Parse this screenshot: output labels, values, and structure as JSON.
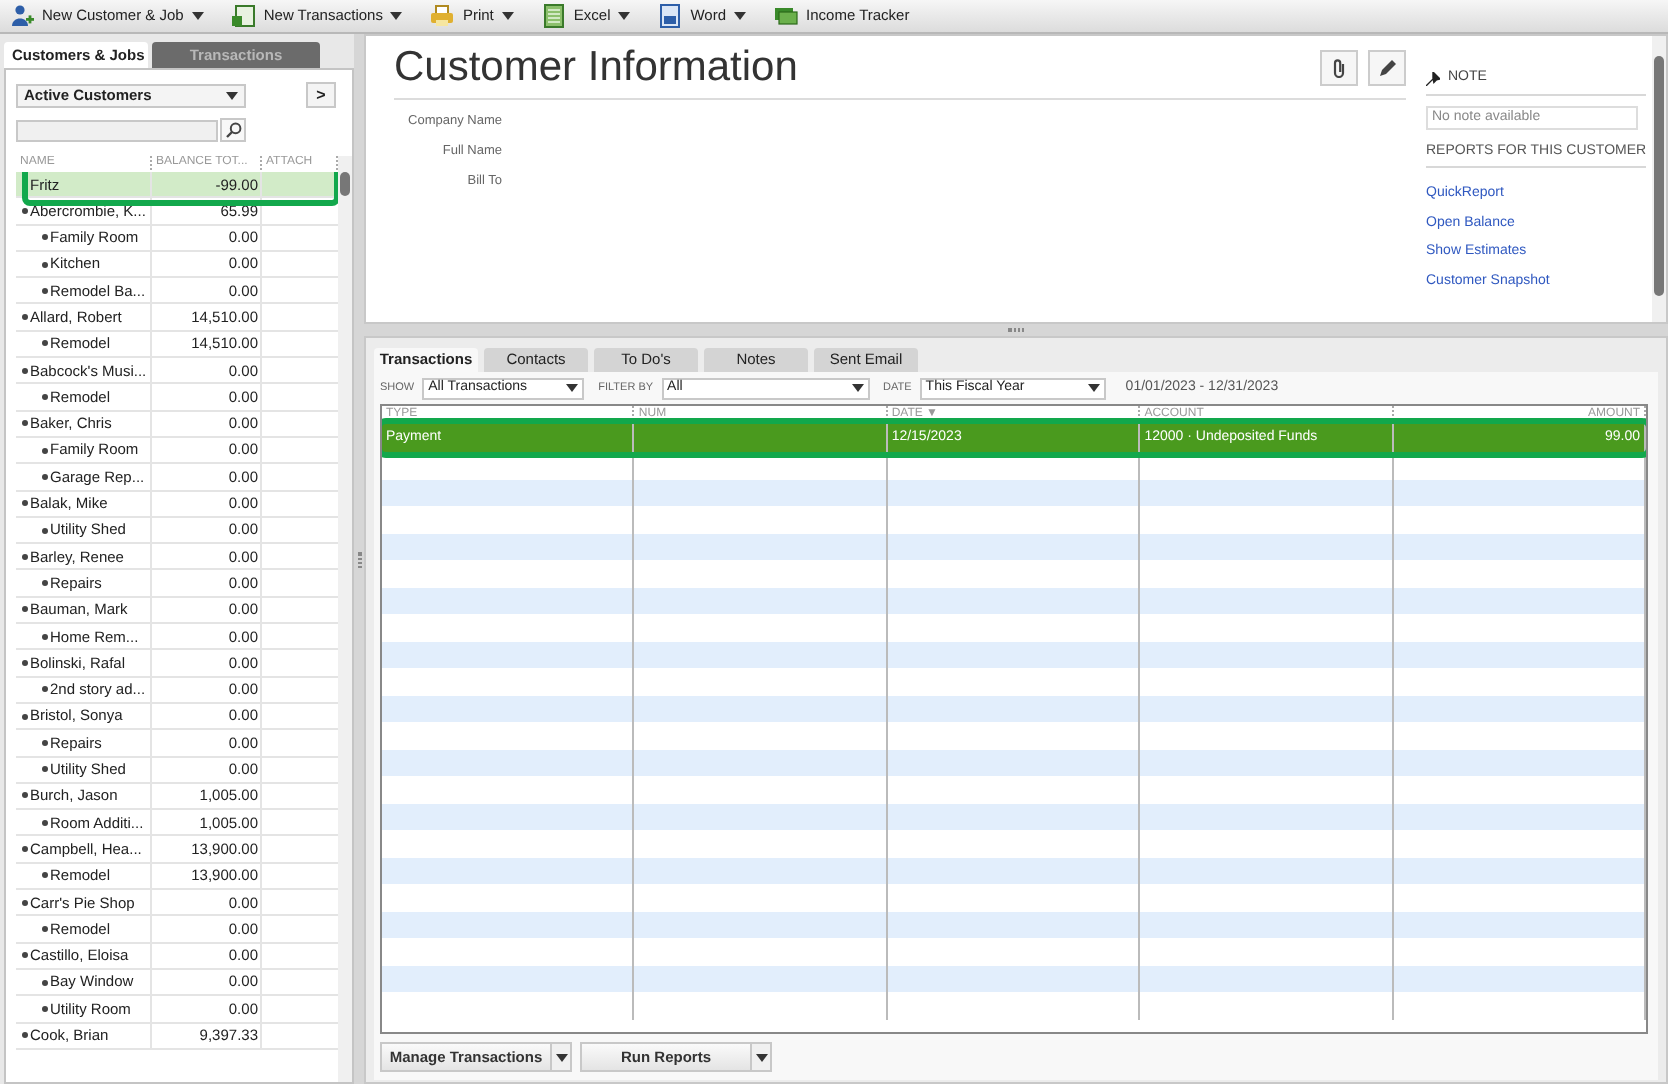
{
  "toolbar": [
    {
      "label": "New Customer & Job",
      "kind": "person",
      "menu": true
    },
    {
      "label": "New Transactions",
      "kind": "form",
      "menu": true
    },
    {
      "label": "Print",
      "kind": "printer",
      "menu": true
    },
    {
      "label": "Excel",
      "kind": "sheet",
      "menu": true
    },
    {
      "label": "Word",
      "kind": "doc",
      "menu": true
    },
    {
      "label": "Income Tracker",
      "kind": "money",
      "menu": false
    }
  ],
  "customer_panel": {
    "tabs": [
      {
        "label": "Customers & Jobs",
        "selected": true
      },
      {
        "label": "Transactions",
        "selected": false
      }
    ],
    "view": "Active Customers",
    "next": ">",
    "columns": [
      "NAME",
      "BALANCE TOT...",
      "ATTACH"
    ],
    "customers": [
      {
        "name": "Fritz",
        "balance": "-99.00",
        "selected": true
      },
      {
        "name": "Abercrombie, K...",
        "balance": "65.99",
        "selected": false,
        "children": [
          {
            "name": "Family Room",
            "balance": "0.00",
            "selected": false
          },
          {
            "name": "Kitchen",
            "balance": "0.00",
            "selected": false
          },
          {
            "name": "Remodel Ba...",
            "balance": "0.00",
            "selected": false
          }
        ]
      },
      {
        "name": "Allard, Robert",
        "balance": "14,510.00",
        "selected": false,
        "children": [
          {
            "name": "Remodel",
            "balance": "14,510.00",
            "selected": false
          }
        ]
      },
      {
        "name": "Babcock's Musi...",
        "balance": "0.00",
        "selected": false,
        "children": [
          {
            "name": "Remodel",
            "balance": "0.00",
            "selected": false
          }
        ]
      },
      {
        "name": "Baker, Chris",
        "balance": "0.00",
        "selected": false,
        "children": [
          {
            "name": "Family Room",
            "balance": "0.00",
            "selected": false
          },
          {
            "name": "Garage Rep...",
            "balance": "0.00",
            "selected": false
          }
        ]
      },
      {
        "name": "Balak, Mike",
        "balance": "0.00",
        "selected": false,
        "children": [
          {
            "name": "Utility Shed",
            "balance": "0.00",
            "selected": false
          }
        ]
      },
      {
        "name": "Barley, Renee",
        "balance": "0.00",
        "selected": false,
        "children": [
          {
            "name": "Repairs",
            "balance": "0.00",
            "selected": false
          }
        ]
      },
      {
        "name": "Bauman, Mark",
        "balance": "0.00",
        "selected": false,
        "children": [
          {
            "name": "Home Rem...",
            "balance": "0.00",
            "selected": false
          }
        ]
      },
      {
        "name": "Bolinski, Rafal",
        "balance": "0.00",
        "selected": false,
        "children": [
          {
            "name": "2nd story ad...",
            "balance": "0.00",
            "selected": false
          }
        ]
      },
      {
        "name": "Bristol, Sonya",
        "balance": "0.00",
        "selected": false,
        "children": [
          {
            "name": "Repairs",
            "balance": "0.00",
            "selected": false
          },
          {
            "name": "Utility Shed",
            "balance": "0.00",
            "selected": false
          }
        ]
      },
      {
        "name": "Burch, Jason",
        "balance": "1,005.00",
        "selected": false,
        "children": [
          {
            "name": "Room Additi...",
            "balance": "1,005.00",
            "selected": false
          }
        ]
      },
      {
        "name": "Campbell, Hea...",
        "balance": "13,900.00",
        "selected": false,
        "children": [
          {
            "name": "Remodel",
            "balance": "13,900.00",
            "selected": false
          }
        ]
      },
      {
        "name": "Carr's Pie Shop",
        "balance": "0.00",
        "selected": false,
        "children": [
          {
            "name": "Remodel",
            "balance": "0.00",
            "selected": false
          }
        ]
      },
      {
        "name": "Castillo, Eloisa",
        "balance": "0.00",
        "selected": false,
        "children": [
          {
            "name": "Bay Window",
            "balance": "0.00",
            "selected": false
          },
          {
            "name": "Utility Room",
            "balance": "0.00",
            "selected": false
          }
        ]
      },
      {
        "name": "Cook, Brian",
        "balance": "9,397.33",
        "selected": false
      }
    ]
  },
  "info": {
    "title": "Customer Information",
    "fields": [
      "Company Name",
      "Full Name",
      "Bill To"
    ],
    "note": {
      "heading": "NOTE",
      "placeholder": "No note available"
    },
    "reports_heading": "REPORTS FOR THIS CUSTOMER",
    "reports": [
      "QuickReport",
      "Open Balance",
      "Show Estimates",
      "Customer Snapshot"
    ]
  },
  "detail": {
    "tabs": [
      {
        "label": "Transactions",
        "selected": true
      },
      {
        "label": "Contacts",
        "selected": false
      },
      {
        "label": "To Do's",
        "selected": false
      },
      {
        "label": "Notes",
        "selected": false
      },
      {
        "label": "Sent Email",
        "selected": false
      }
    ],
    "filters": [
      {
        "label": "SHOW",
        "value": "All Transactions"
      },
      {
        "label": "FILTER BY",
        "value": "All"
      },
      {
        "label": "DATE",
        "value": "This Fiscal Year"
      }
    ],
    "range": "01/01/2023 - 12/31/2023",
    "columns": [
      "TYPE",
      "NUM",
      "DATE ▼",
      "ACCOUNT",
      "AMOUNT"
    ],
    "rows": [
      {
        "type": "Payment",
        "date": "12/15/2023",
        "account": "12000 · Undeposited Funds",
        "amount": "99.00",
        "selected": true
      }
    ],
    "buttons": [
      "Manage Transactions",
      "Run Reports"
    ]
  }
}
